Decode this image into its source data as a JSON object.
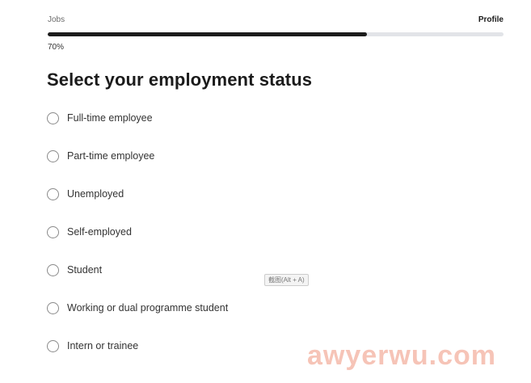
{
  "progress": {
    "current_step": "Jobs",
    "next_step": "Profile",
    "percent_label": "70%",
    "value": 0.7
  },
  "page_title": "Select your employment status",
  "options": [
    {
      "label": "Full-time employee",
      "selected": false
    },
    {
      "label": "Part-time employee",
      "selected": false
    },
    {
      "label": "Unemployed",
      "selected": false
    },
    {
      "label": "Self-employed",
      "selected": false
    },
    {
      "label": "Student",
      "selected": false
    },
    {
      "label": "Working or dual programme student",
      "selected": false
    },
    {
      "label": "Intern or trainee",
      "selected": false
    }
  ],
  "tooltip": "截图(Alt + A)",
  "watermark": "awyerwu.com",
  "colors": {
    "progress_fill": "#1b1b1b",
    "progress_track": "#e2e4e8",
    "watermark": "#f4b19f"
  }
}
